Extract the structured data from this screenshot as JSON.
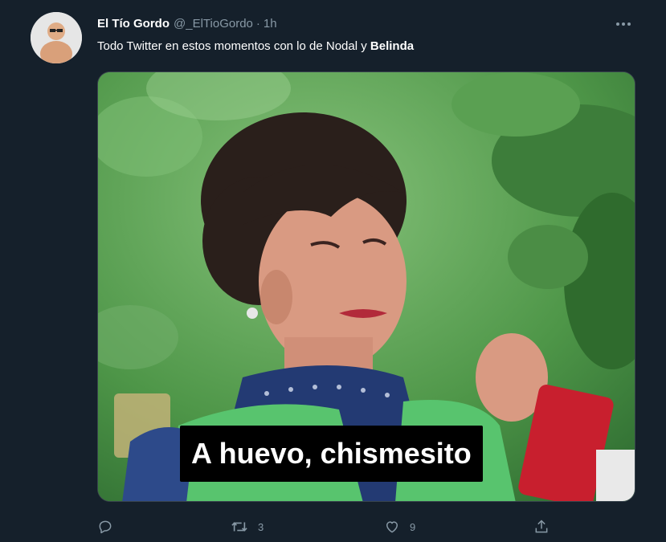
{
  "tweet": {
    "author_name": "El Tío Gordo",
    "handle": "@_ElTioGordo",
    "separator": "·",
    "time": "1h",
    "text_prefix": "Todo Twitter en estos momentos con lo de Nodal y ",
    "text_bold": "Belinda",
    "media_caption": "A huevo, chismesito",
    "more_icon": "more-horizontal-icon"
  },
  "actions": {
    "reply": {
      "icon": "reply-icon",
      "count": ""
    },
    "retweet": {
      "icon": "retweet-icon",
      "count": "3"
    },
    "like": {
      "icon": "heart-icon",
      "count": "9"
    },
    "share": {
      "icon": "share-icon",
      "count": ""
    }
  },
  "colors": {
    "background": "#15202b",
    "text": "#ffffff",
    "secondary_text": "#8899a6",
    "border": "#38444d"
  }
}
